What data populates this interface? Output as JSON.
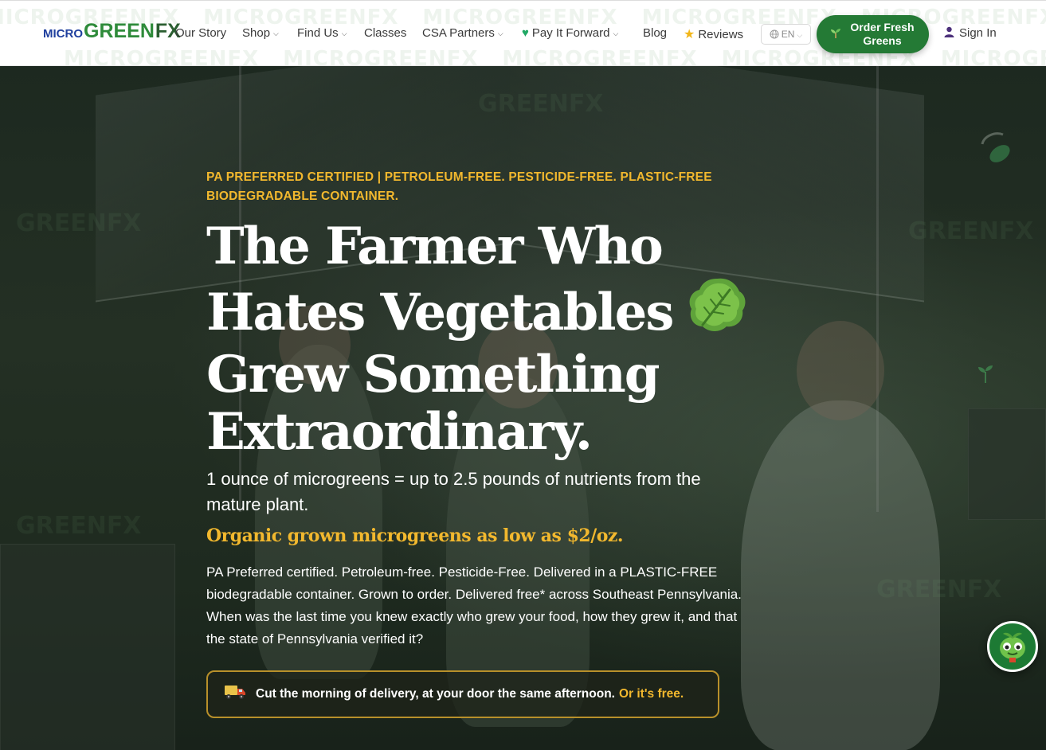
{
  "brand": {
    "micro": "MICRO",
    "green": "GREEN",
    "fx": "FX"
  },
  "nav": {
    "our_story": "Our Story",
    "shop": "Shop",
    "find_us": "Find Us",
    "classes": "Classes",
    "csa_partners": "CSA Partners",
    "pay_it_forward": "Pay It Forward",
    "blog": "Blog",
    "reviews": "Reviews",
    "language": "EN",
    "order_button": "Order Fresh Greens",
    "sign_in": "Sign In"
  },
  "hero": {
    "badge": "PA PREFERRED CERTIFIED | PETROLEUM-FREE. PESTICIDE-FREE. PLASTIC-FREE BIODEGRADABLE CONTAINER.",
    "headline": {
      "line1": "The Farmer Who",
      "line2": "Hates Vegetables",
      "line3": "Grew Something",
      "line4": "Extraordinary."
    },
    "ounce_line": "1 ounce of microgreens = up to 2.5 pounds of nutrients from the mature plant.",
    "price_line": "Organic grown microgreens as low as $2/oz.",
    "body": "PA Preferred certified. Petroleum-free. Pesticide-Free. Delivered in a PLASTIC-FREE biodegradable container. Grown to order. Delivered free* across Southeast Pennsylvania. When was the last time you knew exactly who grew your food, how they grew it, and that the state of Pennsylvania verified it?",
    "delivery_text": "Cut the morning of delivery, at your door the same afternoon.",
    "delivery_free": "Or it's free."
  },
  "icons": {
    "language": "globe-icon",
    "order": "sprout-icon",
    "sign_in": "user-icon",
    "pay_it_forward": "heart-icon",
    "reviews": "star-icon",
    "headline": "kale-icon",
    "delivery": "truck-icon",
    "chat": "mascot-chat-icon"
  },
  "colors": {
    "brand_green": "#247a35",
    "accent_gold": "#f2b82e",
    "brand_blue": "#1f3f9e"
  }
}
